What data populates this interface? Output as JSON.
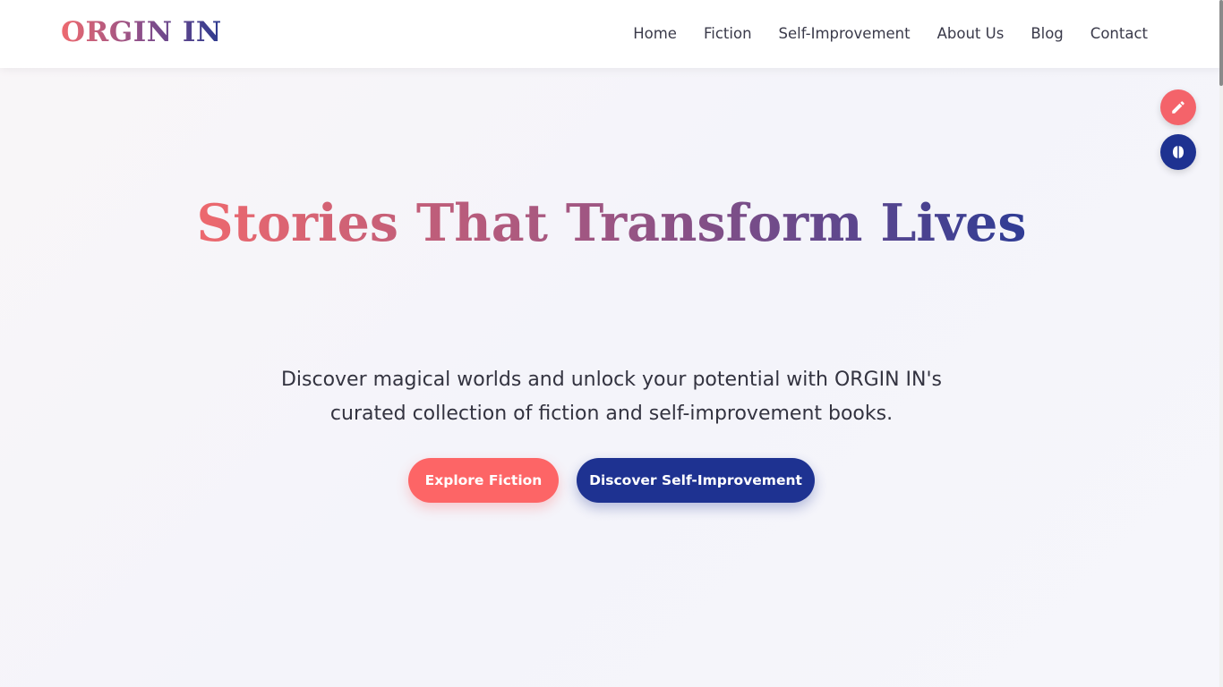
{
  "header": {
    "logo": "ORGIN IN",
    "nav": [
      {
        "label": "Home"
      },
      {
        "label": "Fiction"
      },
      {
        "label": "Self-Improvement"
      },
      {
        "label": "About Us"
      },
      {
        "label": "Blog"
      },
      {
        "label": "Contact"
      }
    ]
  },
  "floating_buttons": [
    {
      "icon": "pencil-icon",
      "color": "#f4636a"
    },
    {
      "icon": "brain-icon",
      "color": "#1e3291"
    }
  ],
  "hero": {
    "title": "Stories That Transform Lives",
    "subtitle": "Discover magical worlds and unlock your potential with ORGIN IN's curated collection of fiction and self-improvement books.",
    "buttons": {
      "primary": "Explore Fiction",
      "secondary": "Discover Self-Improvement"
    }
  },
  "colors": {
    "accent_coral": "#fd6566",
    "accent_navy": "#1e3291"
  }
}
